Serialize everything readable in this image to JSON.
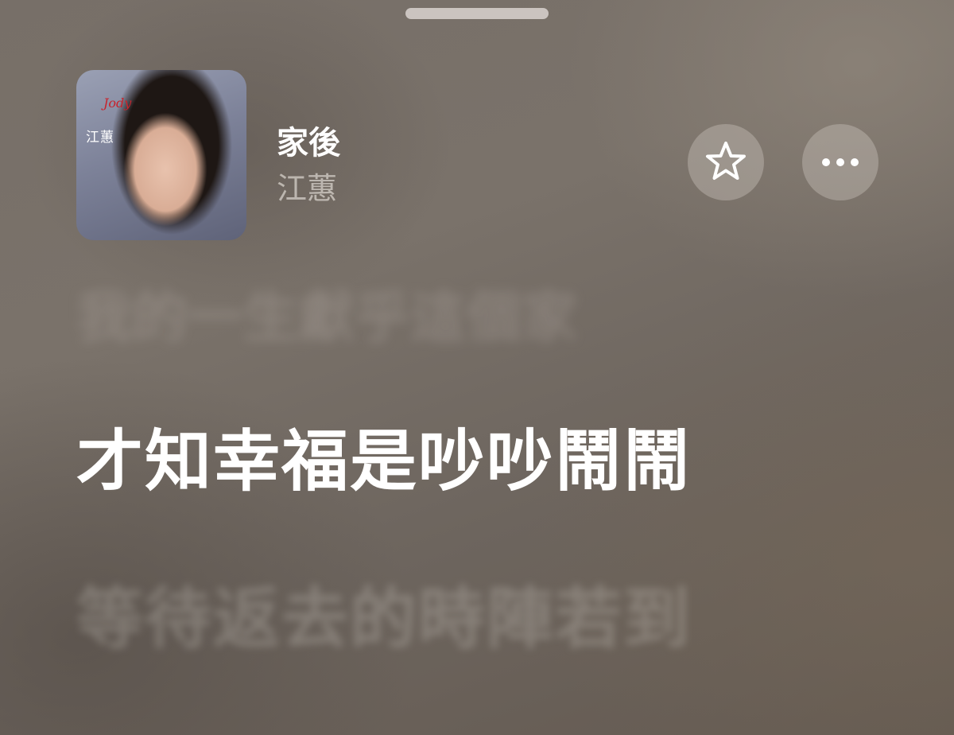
{
  "player": {
    "artwork": {
      "logo_text": "Jody",
      "name_text": "江蕙"
    },
    "song_title": "家後",
    "artist": "江蕙",
    "favorite_icon": "star-outline-icon",
    "more_icon": "ellipsis-icon"
  },
  "lyrics": {
    "previous": "我的一生獻乎這個家",
    "current": "才知幸福是吵吵鬧鬧",
    "next": "等待返去的時陣若到"
  },
  "colors": {
    "background": "#6f6760",
    "active_lyric": "#ffffff",
    "artwork_logo": "#c8232c"
  }
}
